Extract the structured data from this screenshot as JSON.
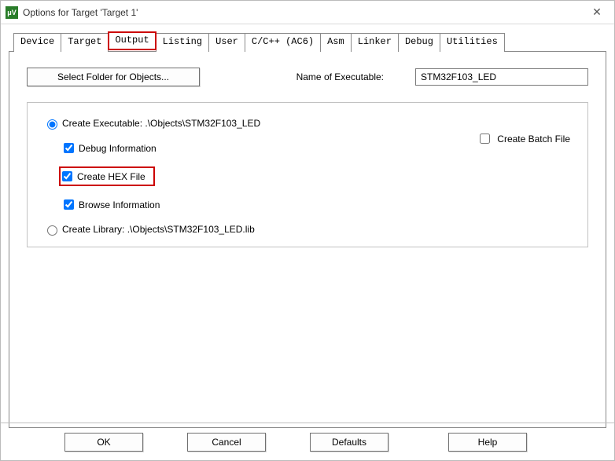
{
  "titlebar": {
    "icon_label": "μV",
    "title": "Options for Target 'Target 1'"
  },
  "tabs": {
    "device": "Device",
    "target": "Target",
    "output": "Output",
    "listing": "Listing",
    "user": "User",
    "cpp": "C/C++ (AC6)",
    "asm": "Asm",
    "linker": "Linker",
    "debug": "Debug",
    "utilities": "Utilities"
  },
  "output": {
    "select_folder_btn": "Select Folder for Objects...",
    "name_label": "Name of Executable:",
    "name_value": "STM32F103_LED",
    "create_exec_label": "Create Executable:  .\\Objects\\STM32F103_LED",
    "debug_info_label": "Debug Information",
    "create_hex_label": "Create HEX File",
    "browse_info_label": "Browse Information",
    "create_batch_label": "Create Batch File",
    "create_lib_label": "Create Library:  .\\Objects\\STM32F103_LED.lib"
  },
  "buttons": {
    "ok": "OK",
    "cancel": "Cancel",
    "defaults": "Defaults",
    "help": "Help"
  }
}
